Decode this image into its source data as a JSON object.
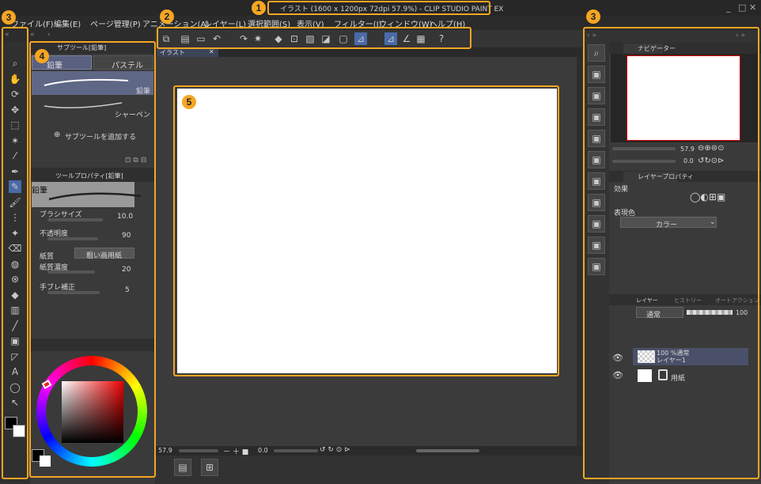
{
  "window": {
    "title": "イラスト (1600 x 1200px 72dpi 57.9%) - CLIP STUDIO PAINT EX",
    "minimize": "_",
    "maximize": "□",
    "close": "✕"
  },
  "menu": [
    "ファイル(F)",
    "編集(E)",
    "ページ管理(P)",
    "アニメーション(A)",
    "レイヤー(L)",
    "選択範囲(S)",
    "表示(V)",
    "フィルター(I)",
    "ウィンドウ(W)",
    "ヘルプ(H)"
  ],
  "callouts": [
    "1",
    "2",
    "3",
    "3",
    "4",
    "5"
  ],
  "canvas_tab": {
    "label": "イラスト",
    "close": "✕"
  },
  "subtool_panel": {
    "title": "サブツール[鉛筆]",
    "tabs": [
      "鉛筆",
      "パステル"
    ],
    "items": [
      "鉛筆",
      "シャーペン"
    ],
    "add_label": "サブツールを追加する"
  },
  "tool_property": {
    "title": "ツールプロパティ[鉛筆]",
    "preview_label": "鉛筆",
    "rows": [
      {
        "label": "ブラシサイズ",
        "value": "10.0"
      },
      {
        "label": "不透明度",
        "value": "90"
      },
      {
        "label": "紙質",
        "value": "粗い画用紙"
      },
      {
        "label": "紙質濃度",
        "value": "20"
      },
      {
        "label": "手ブレ補正",
        "value": "5"
      }
    ]
  },
  "colors": {
    "accent": "#f5a623",
    "main_color": "#000000",
    "sub_color": "#ffffff",
    "layer_selected": "#4a5068"
  },
  "navigator": {
    "tab": "ナビゲーター",
    "zoom": "57.9",
    "rotation": "0.0"
  },
  "layer_property": {
    "tab": "レイヤープロパティ",
    "effect_label": "効果",
    "expression_label": "表現色",
    "expression_value": "カラー"
  },
  "layer_panel": {
    "tabs": [
      "レイヤー",
      "ヒストリー",
      "オートアクション"
    ],
    "blend": "通常",
    "opacity": "100",
    "layers": [
      {
        "line1": "100 %通常",
        "line2": "レイヤー1",
        "selected": true
      },
      {
        "line1": "",
        "line2": "用紙",
        "selected": false
      }
    ]
  },
  "status_bar": {
    "zoom": "57.9",
    "rotation": "0.0"
  },
  "toolbar_icons": [
    "new-icon",
    "open-icon",
    "save-icon",
    "undo-icon",
    "redo-icon",
    "clear-icon",
    "fill-icon",
    "transform-icon",
    "select-none-icon",
    "invert-icon",
    "guide-icon",
    "ruler-snap-icon",
    "ruler-snap-icon",
    "perspective-icon",
    "settings-icon",
    "help-icon"
  ],
  "tool_icons": [
    "zoom-icon",
    "hand-icon",
    "rotate-icon",
    "move-icon",
    "selection-icon",
    "magic-wand-icon",
    "eyedropper-icon",
    "pen-icon",
    "pencil-icon",
    "brush-icon",
    "airbrush-icon",
    "decoration-icon",
    "eraser-icon",
    "blend-icon",
    "gradient-fill-icon",
    "fill-icon",
    "gradient-icon",
    "line-icon",
    "frame-icon",
    "balloon-icon",
    "text-icon",
    "lasso-icon",
    "operation-icon"
  ]
}
